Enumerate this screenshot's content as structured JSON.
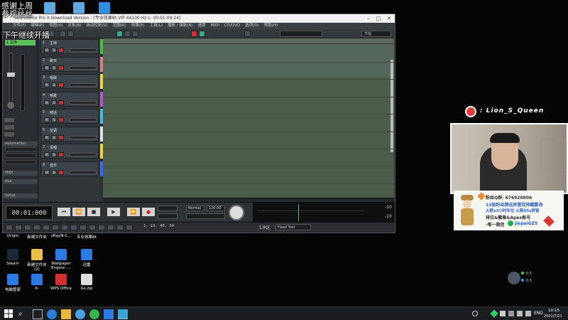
{
  "overlay": {
    "line1": "感谢上周",
    "line2": "参观丝丝",
    "line3": "下午继续开播"
  },
  "top_icons": [
    "",
    "",
    ""
  ],
  "window": {
    "title": "SoundWire Pro X Download Version - [专业效果Bt.VIP   44100 Hz  L: 00:01:09:24]",
    "menu": [
      "文件(F)",
      "编辑(E)",
      "视图(V)",
      "对象(B)",
      "自动控制(U)",
      "范围(R)",
      "效果(E)",
      "工具(L)",
      "播放 / 录制(N)",
      "速度",
      "MIDI",
      "CD/DVD",
      "选项(O)",
      "帮助(H)"
    ],
    "toolbar_dropdown": "节拍"
  },
  "left_panel": {
    "top_label": "1 主持",
    "automation_label": "Automation",
    "section_labels": [
      "MIDI",
      "Aux",
      "Setup"
    ]
  },
  "tracks": [
    {
      "num": "1",
      "name": "主持",
      "color": "#3cc43c"
    },
    {
      "num": "2",
      "name": "聊天",
      "color": "#e07b8a"
    },
    {
      "num": "3",
      "name": "唱歌",
      "color": "#e8d43b"
    },
    {
      "num": "4",
      "name": "喊麦",
      "color": "#b055d8"
    },
    {
      "num": "5",
      "name": "喊话",
      "color": "#3bbfe8"
    },
    {
      "num": "6",
      "name": "空调",
      "color": "#e0e0e0"
    },
    {
      "num": "7",
      "name": "清唱",
      "color": "#e8d43b"
    },
    {
      "num": "8",
      "name": "音乐",
      "color": "#3b6ae8"
    }
  ],
  "transport": {
    "timecode": "00:01:000",
    "buttons": [
      "⏮",
      "⏪",
      "■",
      "▶",
      "⏩",
      "●"
    ],
    "mode": "Normal",
    "tempo": "120.00",
    "position": "1. 19. 40. 30",
    "meter_db": [
      "-10",
      "-10"
    ],
    "work_label": "工作区",
    "work_value": "Fixed Tool"
  },
  "desktop_bottom": [
    {
      "label": "Origin",
      "color": "#2b2b2b"
    },
    {
      "label": "新建文件夹",
      "color": "#2b2b2b"
    },
    {
      "label": "vRayN-C...",
      "color": "#2b2b2b"
    },
    {
      "label": "专业效果Bt",
      "color": "#2b2b2b"
    },
    {
      "label": "Steam",
      "color": "#1b2838"
    },
    {
      "label": "新建文件夹 (2)",
      "color": "#e8c04a"
    },
    {
      "label": "Wallpaper Engine: ...",
      "color": "#2c7be5"
    },
    {
      "label": "迅雷",
      "color": "#2c7be5"
    },
    {
      "label": "电脑管家",
      "color": "#2c7be5"
    },
    {
      "label": "0-",
      "color": "#2c7be5"
    },
    {
      "label": "WPS Office",
      "color": "#d23030"
    },
    {
      "label": "Gs.zip",
      "color": "#dddddd"
    }
  ],
  "stream": {
    "name": "Lion_S_Queen",
    "card": {
      "line1": "粉丝Q群: 676928806",
      "line2": "13级粉丝牌送房管双排鲲鹏海",
      "line3": "火箭x3小时车位  火箭X5z房管",
      "line4": "排位&徽章&Apex账号",
      "line5": "-唯一微信",
      "wechat": "JiepaiGZS"
    },
    "mini_stat1": "0.5",
    "mini_stat2": "0.3"
  },
  "taskbar": {
    "lang": "ENG",
    "time": "10:15",
    "date": "2021/7/21"
  }
}
